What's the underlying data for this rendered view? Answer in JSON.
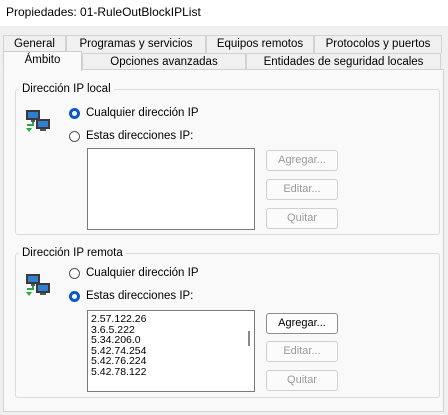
{
  "window": {
    "title": "Propiedades: 01-RuleOutBlockIPList"
  },
  "tabs_back": [
    "General",
    "Programas y servicios",
    "Equipos remotos",
    "Protocolos y puertos"
  ],
  "tabs_front": [
    "Ámbito",
    "Opciones avanzadas",
    "Entidades de seguridad locales"
  ],
  "active_tab": "Ámbito",
  "local": {
    "legend": "Dirección IP local",
    "option_any": "Cualquier dirección IP",
    "option_these": "Estas direcciones IP:",
    "selected": "any",
    "addresses": [],
    "add_label": "Agregar...",
    "edit_label": "Editar...",
    "remove_label": "Quitar"
  },
  "remote": {
    "legend": "Dirección IP remota",
    "option_any": "Cualquier dirección IP",
    "option_these": "Estas direcciones IP:",
    "selected": "these",
    "addresses": [
      "2.57.122.26",
      "3.6.5.222",
      "5.34.206.0",
      "5.42.74.254",
      "5.42.76.224",
      "5.42.78.122"
    ],
    "add_label": "Agregar...",
    "edit_label": "Editar...",
    "remove_label": "Quitar"
  },
  "colors": {
    "accent": "#0a58c9",
    "panel": "#f9f9f9",
    "background": "#f0f0f0"
  }
}
